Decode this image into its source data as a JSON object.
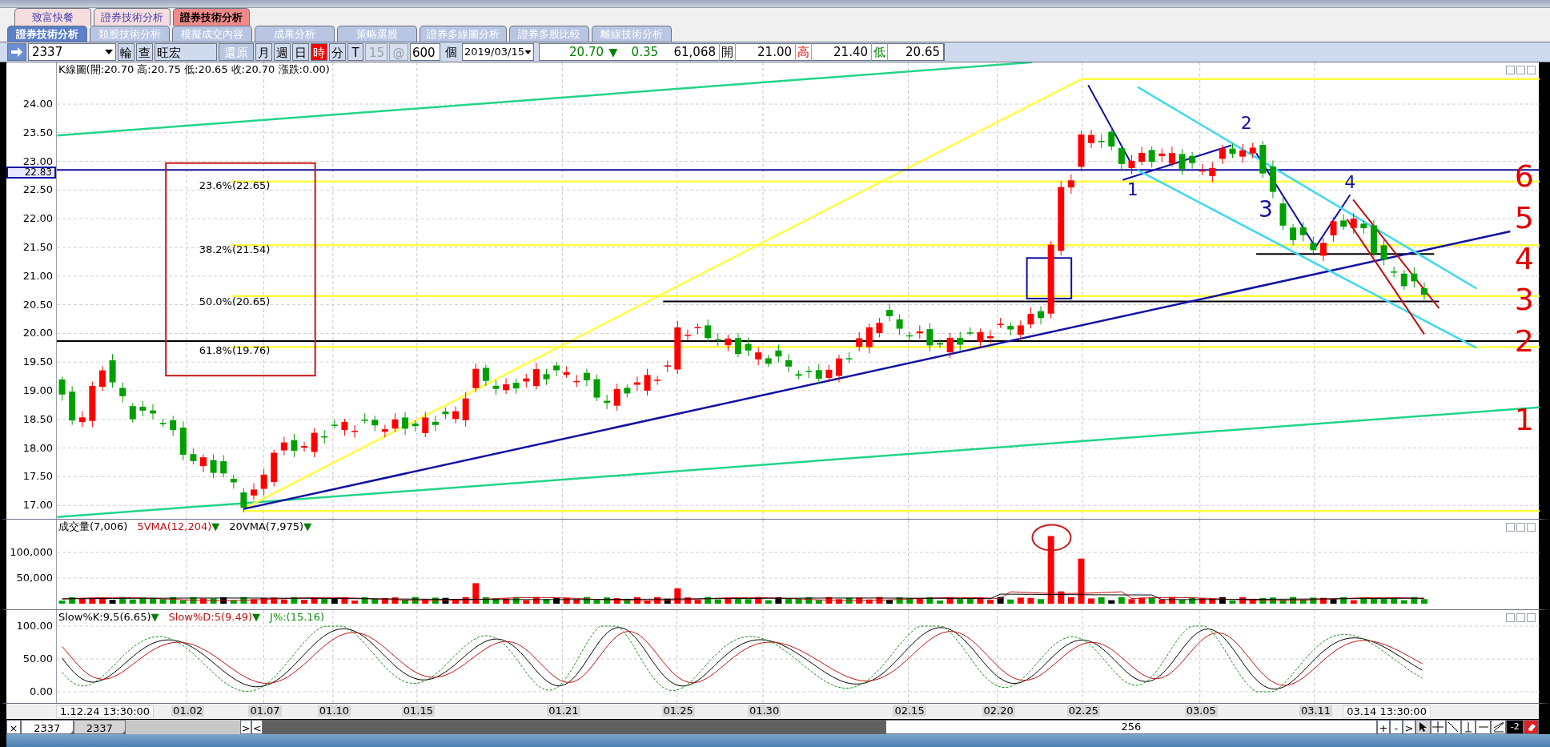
{
  "tabs_primary": [
    {
      "label": "致富快餐",
      "selected": false
    },
    {
      "label": "證券技術分析",
      "selected": false
    },
    {
      "label": "證券技術分析",
      "selected": true
    }
  ],
  "tabs_secondary": [
    {
      "label": "證券技術分析",
      "selected": true
    },
    {
      "label": "類股技術分析",
      "selected": false
    },
    {
      "label": "模擬成交內容",
      "selected": false
    },
    {
      "label": "成果分析",
      "selected": false
    },
    {
      "label": "策略選股",
      "selected": false
    },
    {
      "label": "證券多線圖分析",
      "selected": false
    },
    {
      "label": "證券多股比較",
      "selected": false
    },
    {
      "label": "離線技術分析",
      "selected": false
    }
  ],
  "toolbar": {
    "symbol": "2337",
    "rotate": "輪",
    "query": "查",
    "name": "旺宏",
    "restore": {
      "label": "還原",
      "disabled": true
    },
    "periods": [
      {
        "label": "月",
        "selected": false
      },
      {
        "label": "週",
        "selected": false
      },
      {
        "label": "日",
        "selected": false
      },
      {
        "label": "時",
        "selected": true
      },
      {
        "label": "分",
        "selected": false
      },
      {
        "label": "T",
        "selected": false
      }
    ],
    "interval": {
      "value": "15",
      "disabled": true
    },
    "at": "@",
    "count": "600",
    "count_unit": "個",
    "date": "2019/03/15",
    "quote": {
      "price": "20.70",
      "change_arrow": "▼",
      "change": "0.35",
      "volume": "61,068",
      "open_label": "開",
      "open": "21.00",
      "high_label": "高",
      "high": "21.40",
      "low_label": "低",
      "low": "20.65"
    }
  },
  "price_chart": {
    "title": "K線圖(開:20.70 高:20.75 低:20.65 收:20.70 漲跌:0.00)",
    "y_ticks": [
      "24.00",
      "23.50",
      "23.00",
      "22.50",
      "22.00",
      "21.50",
      "21.00",
      "20.50",
      "20.00",
      "19.50",
      "19.00",
      "18.50",
      "18.00",
      "17.50",
      "17.00"
    ],
    "current_price": "22.83",
    "fib_labels": [
      "23.6%(22.65)",
      "38.2%(21.54)",
      "50.0%(20.65)",
      "61.8%(19.76)"
    ],
    "wave_labels": [
      "1",
      "2",
      "3",
      "4"
    ],
    "count_labels": [
      "6",
      "5",
      "4",
      "3",
      "2",
      "1"
    ]
  },
  "volume_chart": {
    "label": "成交量(7,006)",
    "ma5": "5VMA(12,204)",
    "ma5_arrow": "▼",
    "ma20": "20VMA(7,975)",
    "ma20_arrow": "▼",
    "y_ticks": [
      "100,000",
      "50,000"
    ]
  },
  "kd_chart": {
    "k": "Slow%K:9,5(6.65)",
    "k_arrow": "▼",
    "d": "Slow%D:5(9.49)",
    "d_arrow": "▼",
    "j": "J%:(15.16)",
    "y_ticks": [
      "100.00",
      "50.00",
      "0.00"
    ]
  },
  "x_axis": {
    "start": "1.12.24 13:30:00",
    "labels": [
      "01.02",
      "01.07",
      "01.10",
      "01.15",
      "01.21",
      "01.25",
      "01.30",
      "02.15",
      "02.20",
      "02.25",
      "03.05",
      "03.11"
    ],
    "end": "03.14 13:30:00"
  },
  "bottom_bar": {
    "close": "×",
    "tabs": [
      {
        "label": "2337",
        "selected": true
      },
      {
        "label": "2337",
        "selected": false
      }
    ],
    "next": ">",
    "prev": "<",
    "count": "256",
    "zoom_in": "+",
    "zoom_out": "-",
    "forward": ">",
    "step": "-2"
  }
}
